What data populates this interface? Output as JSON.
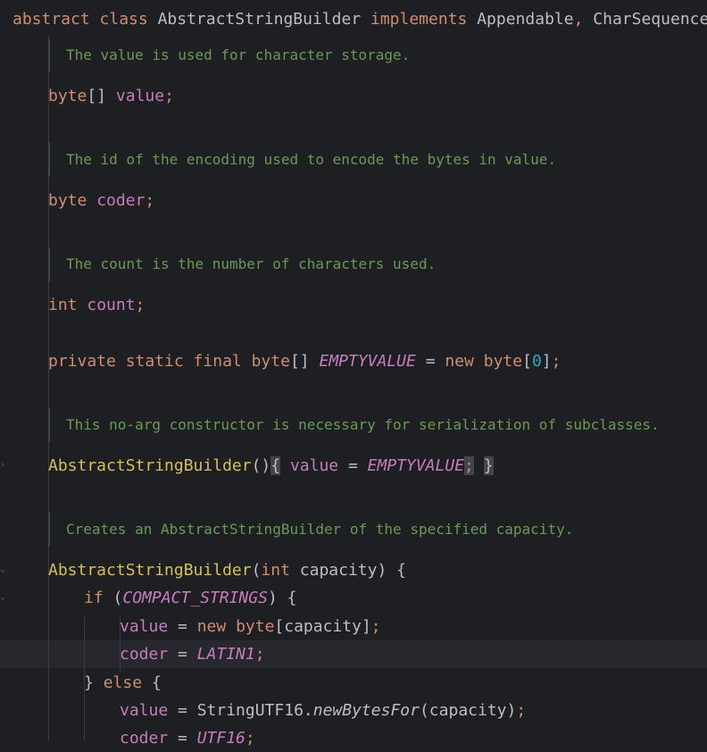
{
  "code": {
    "class_decl": {
      "kw1": "abstract",
      "kw2": "class",
      "name": "AbstractStringBuilder",
      "kw3": "implements",
      "iface1": "Appendable",
      "comma": ",",
      "iface2": "CharSequence",
      "brace": " {"
    },
    "doc_value": "The value is used for character storage.",
    "field_value": {
      "type": "byte",
      "brackets": "[]",
      "name": "value",
      "semi": ";"
    },
    "doc_coder": "The id of the encoding used to encode the bytes in value.",
    "field_coder": {
      "type": "byte",
      "name": "coder",
      "semi": ";"
    },
    "doc_count": "The count is the number of characters used.",
    "field_count": {
      "type": "int",
      "name": "count",
      "semi": ";"
    },
    "empty_decl": {
      "mods": "private static final",
      "type": "byte",
      "brackets": "[]",
      "name": "EMPTYVALUE",
      "eq": " = ",
      "new": "new",
      "type2": "byte",
      "open": "[",
      "num": "0",
      "close": "]",
      "semi": ";"
    },
    "doc_ctor0": "This no-arg constructor is necessary for serialization of subclasses.",
    "ctor0": {
      "name": "AbstractStringBuilder",
      "parens": "()",
      "open": "{",
      "field": "value",
      "eq": " = ",
      "const": "EMPTYVALUE",
      "semi": ";",
      "close": "}"
    },
    "doc_ctor1": "Creates an AbstractStringBuilder of the specified capacity.",
    "ctor1": {
      "name": "AbstractStringBuilder",
      "lparen": "(",
      "type": "int",
      "param": " capacity) {"
    },
    "if_line": {
      "kw": "if",
      "open": " (",
      "const": "COMPACT_STRINGS",
      "close": ") {"
    },
    "assign1": {
      "field": "value",
      "eq": " = ",
      "new": "new",
      "type": "byte",
      "rest": "[capacity]",
      "semi": ";"
    },
    "assign2": {
      "field": "coder",
      "eq": " = ",
      "const": "LATIN1",
      "semi": ";"
    },
    "else_line": {
      "close": "} ",
      "kw": "else",
      "open": " {"
    },
    "assign3": {
      "field": "value",
      "eq": " = ",
      "cls": "StringUTF16.",
      "method": "newBytesFor",
      "rest": "(capacity)",
      "semi": ";"
    },
    "assign4": {
      "field": "coder",
      "eq": " = ",
      "const": "UTF16",
      "semi": ";"
    }
  }
}
